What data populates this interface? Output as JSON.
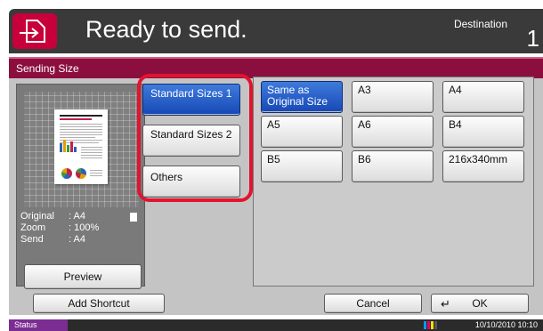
{
  "header": {
    "title": "Ready to send.",
    "destination_label": "Destination",
    "destination_count": "1",
    "send_icon": "send-icon"
  },
  "function_title": "Sending Size",
  "original_info": [
    {
      "key": "Original",
      "value": ": A4"
    },
    {
      "key": "Zoom",
      "value": ": 100%"
    },
    {
      "key": "Send",
      "value": ": A4"
    }
  ],
  "preview_label": "Preview",
  "categories": [
    {
      "label": "Standard Sizes 1",
      "selected": true
    },
    {
      "label": "Standard Sizes 2",
      "selected": false
    },
    {
      "label": "Others",
      "selected": false
    }
  ],
  "sizes": [
    {
      "label": "Same as Original Size",
      "selected": true
    },
    {
      "label": "A3",
      "selected": false
    },
    {
      "label": "A4",
      "selected": false
    },
    {
      "label": "A5",
      "selected": false
    },
    {
      "label": "A6",
      "selected": false
    },
    {
      "label": "B4",
      "selected": false
    },
    {
      "label": "B5",
      "selected": false
    },
    {
      "label": "B6",
      "selected": false
    },
    {
      "label": "216x340mm",
      "selected": false
    }
  ],
  "bottom": {
    "add_shortcut": "Add Shortcut",
    "cancel": "Cancel",
    "ok": "OK"
  },
  "status": {
    "label": "Status",
    "datetime": "10/10/2010  10:10"
  },
  "colors": {
    "accent": "#c7003b",
    "function_bar": "#8c0e3e",
    "selected": "#1648b6",
    "highlight_frame": "#e3132f",
    "status_button": "#7b2d92",
    "toner": [
      "#00a0e0",
      "#e0007a",
      "#ffe100",
      "#111111"
    ]
  }
}
